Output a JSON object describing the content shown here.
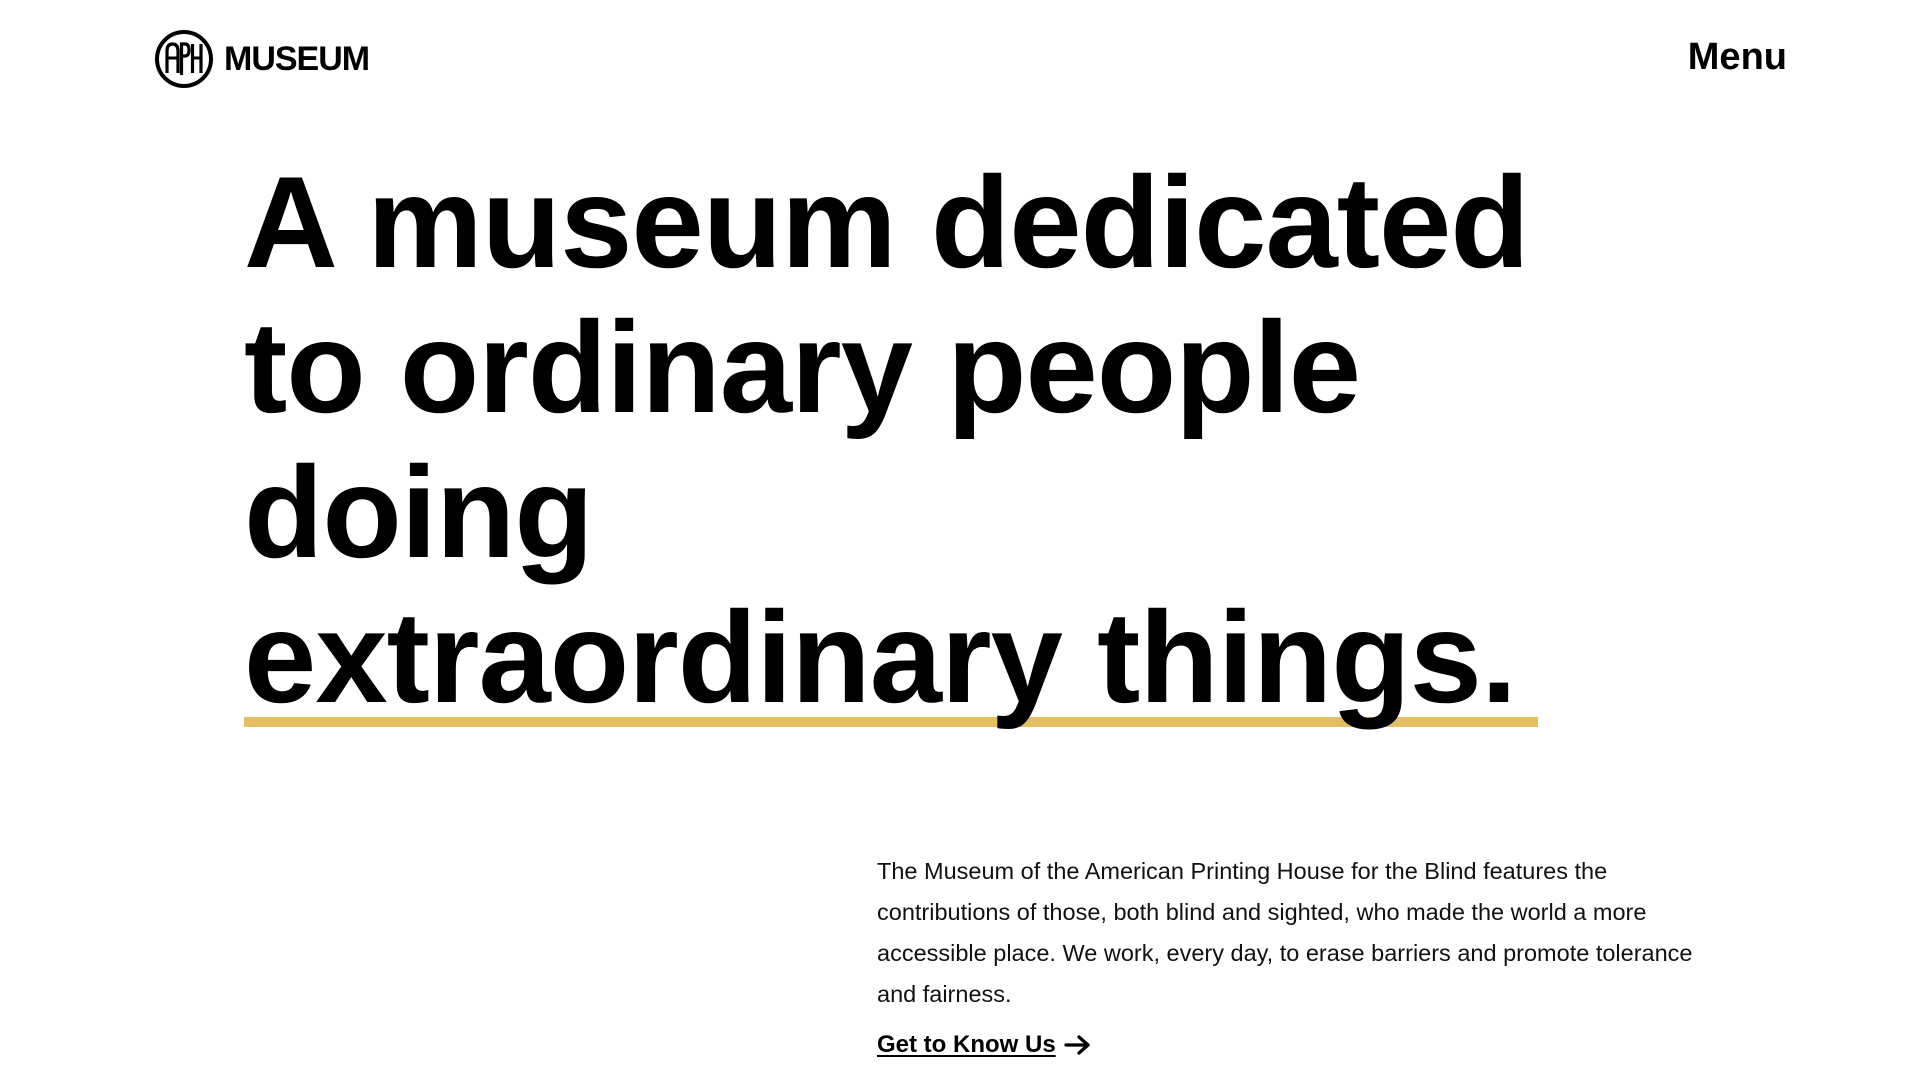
{
  "header": {
    "logo_text": "MUSEUM",
    "logo_monogram": "APH",
    "menu_label": "Menu"
  },
  "hero": {
    "lines": [
      "A museum dedicated",
      "to ordinary people",
      "doing",
      "extraordinary things."
    ],
    "underline_color": "#e3bf62"
  },
  "intro": {
    "text": "The Museum of the American Printing House for the Blind features the contributions of those, both blind and sighted, who made the world a more accessible place. We work, every day, to erase barriers and promote tolerance and fairness.",
    "cta_label": "Get to Know Us",
    "cta_icon": "arrow-right-icon"
  },
  "colors": {
    "background": "#ffffff",
    "text": "#000000",
    "accent": "#e3bf62"
  }
}
